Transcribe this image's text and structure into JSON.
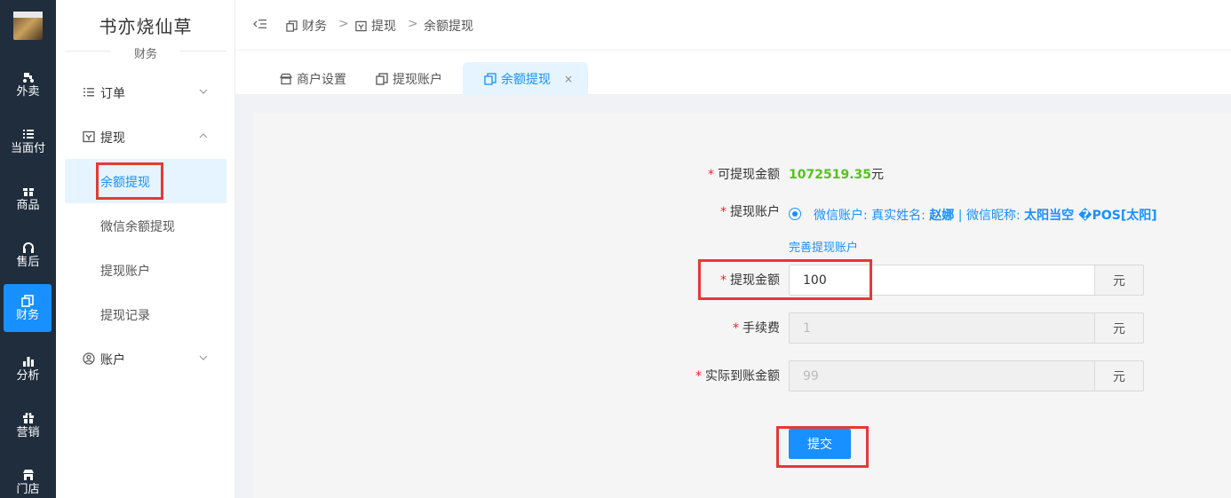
{
  "rail": {
    "items": [
      {
        "label": "外卖"
      },
      {
        "label": "当面付"
      },
      {
        "label": "商品"
      },
      {
        "label": "售后"
      },
      {
        "label": "财务"
      },
      {
        "label": "分析"
      },
      {
        "label": "营销"
      },
      {
        "label": "门店"
      }
    ],
    "active_index": 4,
    "active_color": "#1890ff",
    "background": "#1f2d3d"
  },
  "sidebar": {
    "store_name": "书亦烧仙草",
    "section_title": "财务",
    "menu": {
      "orders": {
        "label": "订单"
      },
      "withdraw": {
        "label": "提现",
        "children": [
          "余额提现",
          "微信余额提现",
          "提现账户",
          "提现记录"
        ],
        "active_child": "余额提现"
      },
      "account": {
        "label": "账户"
      }
    }
  },
  "breadcrumb": {
    "items": [
      "财务",
      "提现",
      "余额提现"
    ],
    "separator": ">"
  },
  "tabs": {
    "items": [
      {
        "label": "商户设置"
      },
      {
        "label": "提现账户"
      },
      {
        "label": "余额提现",
        "close": "×"
      }
    ],
    "active_index": 2
  },
  "form": {
    "required_mark": "*",
    "available": {
      "label": "可提现金额",
      "amount": "1072519.35",
      "unit": "元",
      "amount_color": "#52c41a"
    },
    "account": {
      "label": "提现账户",
      "prefix": "微信账户: 真实姓名: ",
      "real_name": "赵娜",
      "middle": " | 微信昵称: ",
      "nickname": "太阳当空 �POS[太阳]",
      "link": "完善提现账户"
    },
    "withdraw_amount": {
      "label": "提现金额",
      "value": "100",
      "unit": "元"
    },
    "fee": {
      "label": "手续费",
      "value": "1",
      "unit": "元"
    },
    "actual": {
      "label": "实际到账金额",
      "value": "99",
      "unit": "元"
    },
    "submit_label": "提交"
  },
  "accent_color": "#1890ff",
  "highlight_color": "#e53935"
}
